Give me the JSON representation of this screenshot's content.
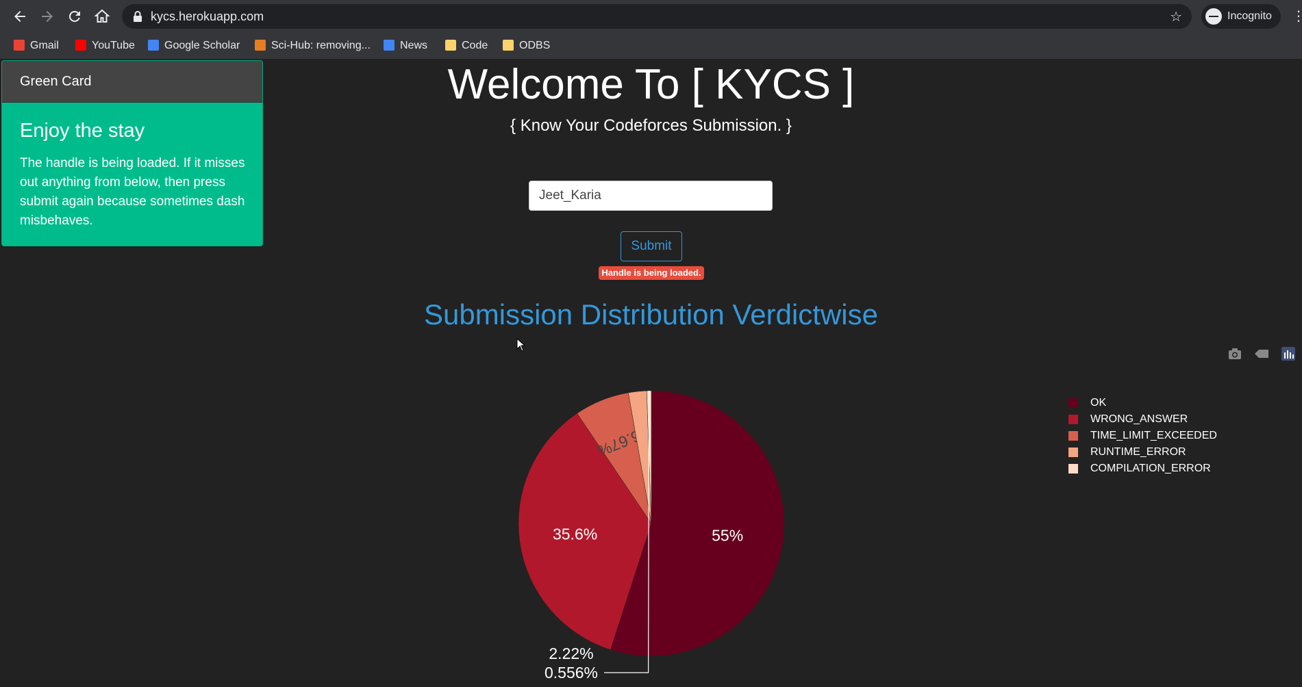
{
  "browser": {
    "url": "kycs.herokuapp.com",
    "profile_label": "Incognito",
    "bookmarks": [
      {
        "label": "Gmail",
        "icon": "gmail-icon",
        "color": "#ea4335"
      },
      {
        "label": "YouTube",
        "icon": "youtube-icon",
        "color": "#ff0000"
      },
      {
        "label": "Google Scholar",
        "icon": "google-scholar-icon",
        "color": "#4285f4"
      },
      {
        "label": "Sci-Hub: removing...",
        "icon": "sci-hub-icon",
        "color": "#e67e22"
      },
      {
        "label": "News",
        "icon": "google-news-icon",
        "color": "#4285f4"
      },
      {
        "label": "Code",
        "icon": "folder-icon",
        "color": "#f9d36b"
      },
      {
        "label": "ODBS",
        "icon": "folder-icon",
        "color": "#f9d36b"
      }
    ]
  },
  "card": {
    "header": "Green Card",
    "title": "Enjoy the stay",
    "text": "The handle is being loaded. If it misses out anything from below, then press submit again because sometimes dash misbehaves."
  },
  "page": {
    "title": "Welcome To [ KYCS ]",
    "subtitle": "{ Know Your Codeforces Submission. }",
    "handle_value": "Jeet_Karia",
    "submit_label": "Submit",
    "status_badge": "Handle is being loaded.",
    "chart_heading": "Submission Distribution Verdictwise"
  },
  "modebar": {
    "icons": [
      "camera-icon",
      "tag-icon",
      "plotly-logo-icon"
    ]
  },
  "chart_data": {
    "type": "pie",
    "title": "Submission Distribution Verdictwise",
    "categories": [
      "OK",
      "WRONG_ANSWER",
      "TIME_LIMIT_EXCEEDED",
      "RUNTIME_ERROR",
      "COMPILATION_ERROR"
    ],
    "values": [
      55,
      35.6,
      6.67,
      2.22,
      0.556
    ],
    "labels": [
      "55%",
      "35.6%",
      "6.67%",
      "2.22%",
      "0.556%"
    ],
    "colors": [
      "#67001f",
      "#b2182b",
      "#d6604d",
      "#f4a582",
      "#fddbc7"
    ],
    "legend_position": "right"
  }
}
